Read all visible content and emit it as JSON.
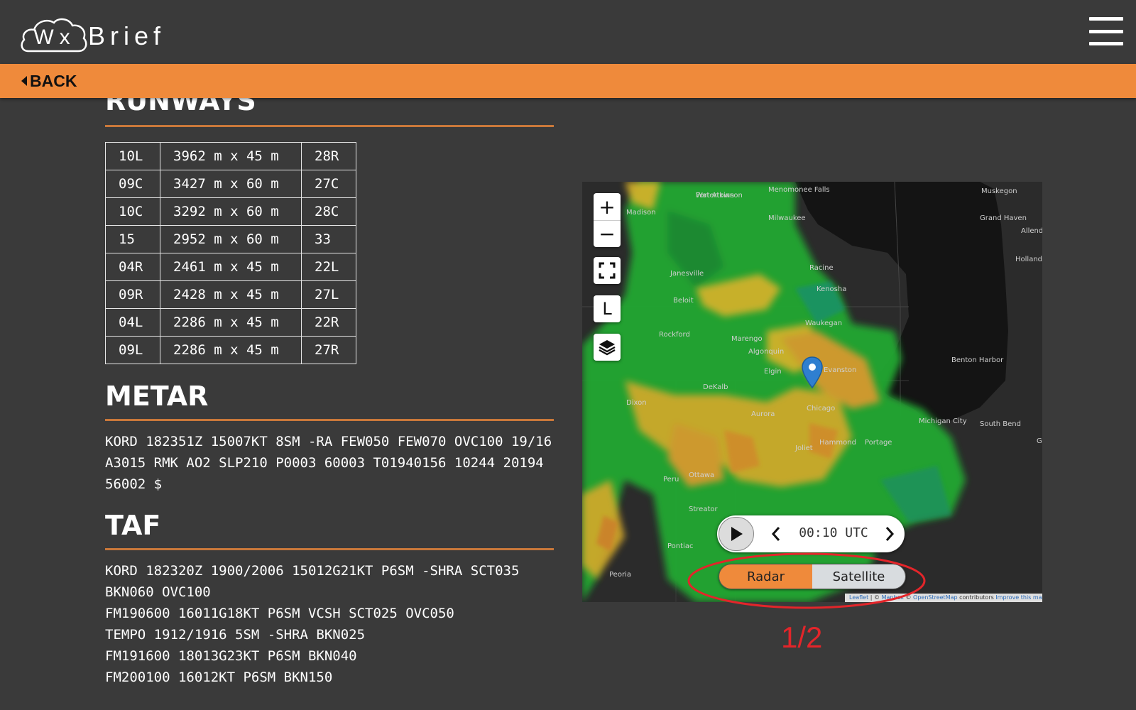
{
  "header": {
    "logo_wx": "Wx",
    "logo_brief": "Brief",
    "menu_icon": "hamburger-menu-icon"
  },
  "backbar": {
    "back_label": "BACK"
  },
  "runways": {
    "title": "RUNWAYS",
    "rows": [
      {
        "id": "10L",
        "size": "3962 m x 45 m",
        "opposite": "28R"
      },
      {
        "id": "09C",
        "size": "3427 m x 60 m",
        "opposite": "27C"
      },
      {
        "id": "10C",
        "size": "3292 m x 60 m",
        "opposite": "28C"
      },
      {
        "id": "15",
        "size": "2952 m x 60 m",
        "opposite": "33"
      },
      {
        "id": "04R",
        "size": "2461 m x 45 m",
        "opposite": "22L"
      },
      {
        "id": "09R",
        "size": "2428 m x 45 m",
        "opposite": "27L"
      },
      {
        "id": "04L",
        "size": "2286 m x 45 m",
        "opposite": "22R"
      },
      {
        "id": "09L",
        "size": "2286 m x 45 m",
        "opposite": "27R"
      }
    ]
  },
  "metar": {
    "title": "METAR",
    "text": "KORD 182351Z 15007KT 8SM -RA FEW050 FEW070 OVC100 19/16 A3015 RMK AO2 SLP210 P0003 60003 T01940156 10244 20194 56002 $"
  },
  "taf": {
    "title": "TAF",
    "lines": [
      "KORD 182320Z 1900/2006 15012G21KT P6SM -SHRA SCT035 BKN060 OVC100",
      "FM190600 16011G18KT P6SM VCSH SCT025 OVC050",
      "TEMPO 1912/1916 5SM -SHRA BKN025",
      "FM191600 18013G23KT P6SM BKN040",
      "FM200100 16012KT P6SM BKN150"
    ]
  },
  "map": {
    "zoom_in": "+",
    "zoom_out": "−",
    "legend_button": "L",
    "time": "00:10 UTC",
    "layers": [
      "Radar",
      "Satellite"
    ],
    "selected_layer": "Radar",
    "attribution": {
      "leaflet": "Leaflet",
      "sep": " | © ",
      "mapbox": "Mapbox",
      "osm_prefix": " © ",
      "osm": "OpenStreetMap",
      "contrib": " contributors ",
      "improve": "Improve this map"
    },
    "places": [
      "Muskegon",
      "Grand Haven",
      "Allendale",
      "Holland",
      "Menomonee Falls",
      "Milwaukee",
      "Watertown",
      "Madison",
      "Racine",
      "Kenosha",
      "Janesville",
      "Beloit",
      "Waukegan",
      "Rockford",
      "Marengo",
      "Algonquin",
      "Elgin",
      "Evanston",
      "Benton Harbor",
      "DeKalb",
      "Chicago",
      "Aurora",
      "Dixon",
      "Michigan City",
      "South Bend",
      "Hammond",
      "Portage",
      "Joliet",
      "Ottawa",
      "Peru",
      "Streator",
      "Pontiac",
      "Peoria",
      "Fort Atkinson",
      "G"
    ]
  },
  "annotation": {
    "page_counter": "1/2"
  },
  "colors": {
    "background": "#3a3a3a",
    "accent": "#ef8a3b",
    "rule": "#c9783a",
    "annotation_red": "#e3252a"
  }
}
